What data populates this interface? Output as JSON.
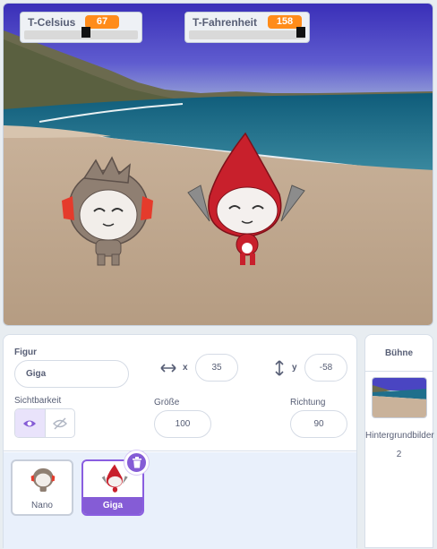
{
  "monitors": [
    {
      "label": "T-Celsius",
      "value": "67",
      "level": 0.55
    },
    {
      "label": "T-Fahrenheit",
      "value": "158",
      "level": 1.0
    }
  ],
  "sprite_info": {
    "figur_label": "Figur",
    "name": "Giga",
    "x_label": "x",
    "x": "35",
    "y_label": "y",
    "y": "-58",
    "visibility_label": "Sichtbarkeit",
    "size_label": "Größe",
    "size": "100",
    "direction_label": "Richtung",
    "direction": "90"
  },
  "sprites": [
    {
      "name": "Nano",
      "selected": false
    },
    {
      "name": "Giga",
      "selected": true
    }
  ],
  "stage_panel": {
    "title": "Bühne",
    "backdrops_label": "Hintergrundbilder",
    "backdrops_count": "2"
  },
  "colors": {
    "accent": "#855cd6",
    "monitor_value": "#ff8c1a",
    "text": "#575e75"
  }
}
